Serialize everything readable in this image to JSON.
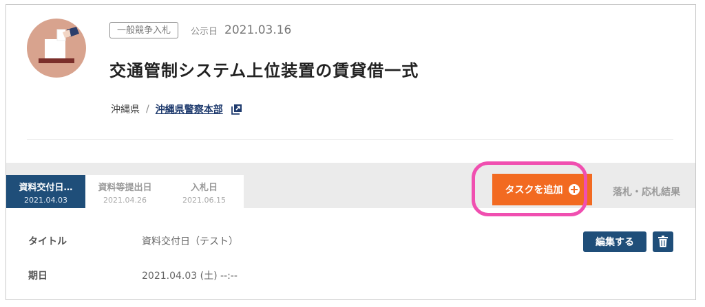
{
  "header": {
    "type_badge": "一般競争入札",
    "publish_label": "公示日",
    "publish_date": "2021.03.16",
    "title": "交通管制システム上位装置の賃貸借一式"
  },
  "location": {
    "prefecture": "沖縄県",
    "separator": "/",
    "agency": "沖縄県警察本部",
    "external_icon": "external-link-icon"
  },
  "tabs": [
    {
      "label": "資料交付日…",
      "date": "2021.04.03",
      "active": true
    },
    {
      "label": "資料等提出日",
      "date": "2021.04.26",
      "active": false
    },
    {
      "label": "入札日",
      "date": "2021.06.15",
      "active": false
    }
  ],
  "actions": {
    "add_task_label": "タスクを追加",
    "add_task_icon": "plus-circle-icon",
    "result_tab_label": "落札・応札結果"
  },
  "details": {
    "title_label": "タイトル",
    "title_value": "資料交付日（テスト）",
    "due_label": "期日",
    "due_value": "2021.04.03 (土) --:--",
    "edit_label": "編集する",
    "delete_icon": "trash-icon"
  },
  "colors": {
    "accent_orange": "#f26a21",
    "navy": "#1f4e79",
    "highlight": "#f04fb0"
  }
}
